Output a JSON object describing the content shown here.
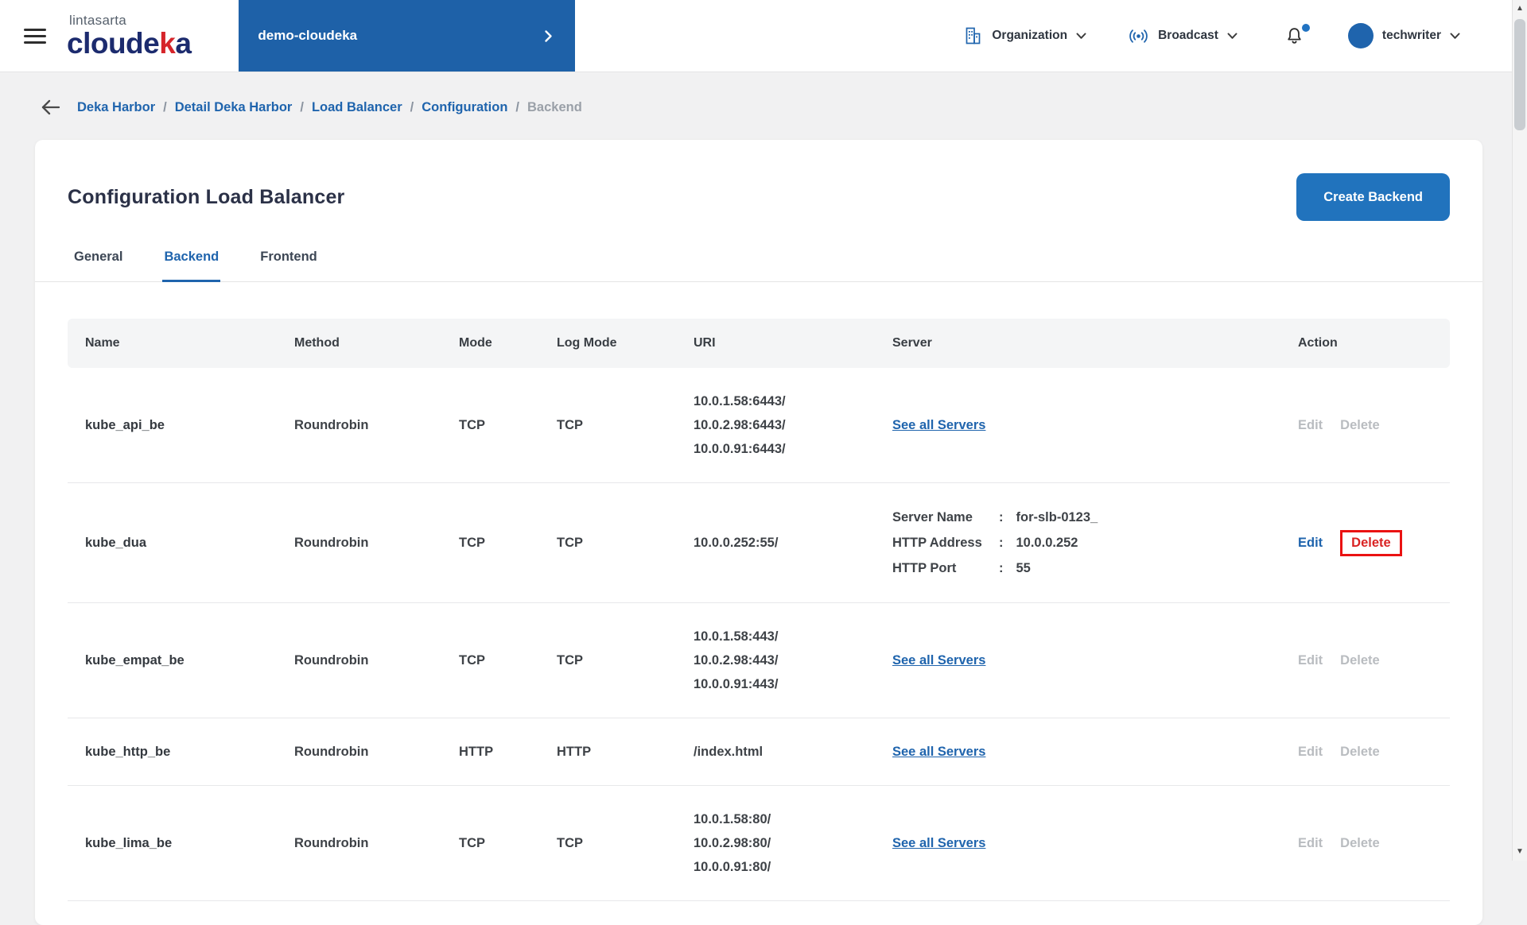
{
  "colors": {
    "primary_blue": "#1f64ad",
    "button_blue": "#2173bd",
    "project_box_blue": "#1e61a8",
    "brand_navy": "#1c2b6e",
    "brand_red": "#d6252a",
    "danger_red": "#d92323",
    "highlight_box_red": "#ea1212",
    "muted_gray": "#b9bcc0"
  },
  "header": {
    "brand": {
      "top": "lintasarta",
      "main_part1": "cloude",
      "main_accent": "k",
      "main_part2": "a"
    },
    "project": {
      "label": "demo-cloudeka"
    },
    "organization_label": "Organization",
    "broadcast_label": "Broadcast",
    "user_name": "techwriter"
  },
  "breadcrumb": {
    "separator": "/",
    "items": [
      {
        "label": "Deka Harbor"
      },
      {
        "label": "Detail Deka Harbor"
      },
      {
        "label": "Load Balancer"
      },
      {
        "label": "Configuration"
      },
      {
        "label": "Backend"
      }
    ]
  },
  "page": {
    "title": "Configuration Load Balancer",
    "create_button_label": "Create Backend",
    "tabs": [
      {
        "label": "General",
        "active": false
      },
      {
        "label": "Backend",
        "active": true
      },
      {
        "label": "Frontend",
        "active": false
      }
    ]
  },
  "table": {
    "columns": [
      "Name",
      "Method",
      "Mode",
      "Log Mode",
      "URI",
      "Server",
      "Action"
    ],
    "rows": [
      {
        "name": "kube_api_be",
        "method": "Roundrobin",
        "mode": "TCP",
        "log_mode": "TCP",
        "uri": [
          "10.0.1.58:6443/",
          "10.0.2.98:6443/",
          "10.0.0.91:6443/"
        ],
        "server_link": "See all Servers",
        "actions": {
          "edit": "Edit",
          "delete": "Delete"
        },
        "edit_active": false,
        "delete_danger": false,
        "delete_boxed": false
      },
      {
        "name": "kube_dua",
        "method": "Roundrobin",
        "mode": "TCP",
        "log_mode": "TCP",
        "uri": [
          "10.0.0.252:55/"
        ],
        "server_details": [
          {
            "key": "Server Name",
            "value": "for-slb-0123_"
          },
          {
            "key": "HTTP Address",
            "value": "10.0.0.252"
          },
          {
            "key": "HTTP Port",
            "value": "55"
          }
        ],
        "actions": {
          "edit": "Edit",
          "delete": "Delete"
        },
        "edit_active": true,
        "delete_danger": true,
        "delete_boxed": true
      },
      {
        "name": "kube_empat_be",
        "method": "Roundrobin",
        "mode": "TCP",
        "log_mode": "TCP",
        "uri": [
          "10.0.1.58:443/",
          "10.0.2.98:443/",
          "10.0.0.91:443/"
        ],
        "server_link": "See all Servers",
        "actions": {
          "edit": "Edit",
          "delete": "Delete"
        },
        "edit_active": false,
        "delete_danger": false,
        "delete_boxed": false
      },
      {
        "name": "kube_http_be",
        "method": "Roundrobin",
        "mode": "HTTP",
        "log_mode": "HTTP",
        "uri": [
          "/index.html"
        ],
        "server_link": "See all Servers",
        "actions": {
          "edit": "Edit",
          "delete": "Delete"
        },
        "edit_active": false,
        "delete_danger": false,
        "delete_boxed": false
      },
      {
        "name": "kube_lima_be",
        "method": "Roundrobin",
        "mode": "TCP",
        "log_mode": "TCP",
        "uri": [
          "10.0.1.58:80/",
          "10.0.2.98:80/",
          "10.0.0.91:80/"
        ],
        "server_link": "See all Servers",
        "actions": {
          "edit": "Edit",
          "delete": "Delete"
        },
        "edit_active": false,
        "delete_danger": false,
        "delete_boxed": false
      }
    ]
  },
  "scrollbar": {
    "up_arrow": "▲",
    "down_arrow": "▼"
  }
}
